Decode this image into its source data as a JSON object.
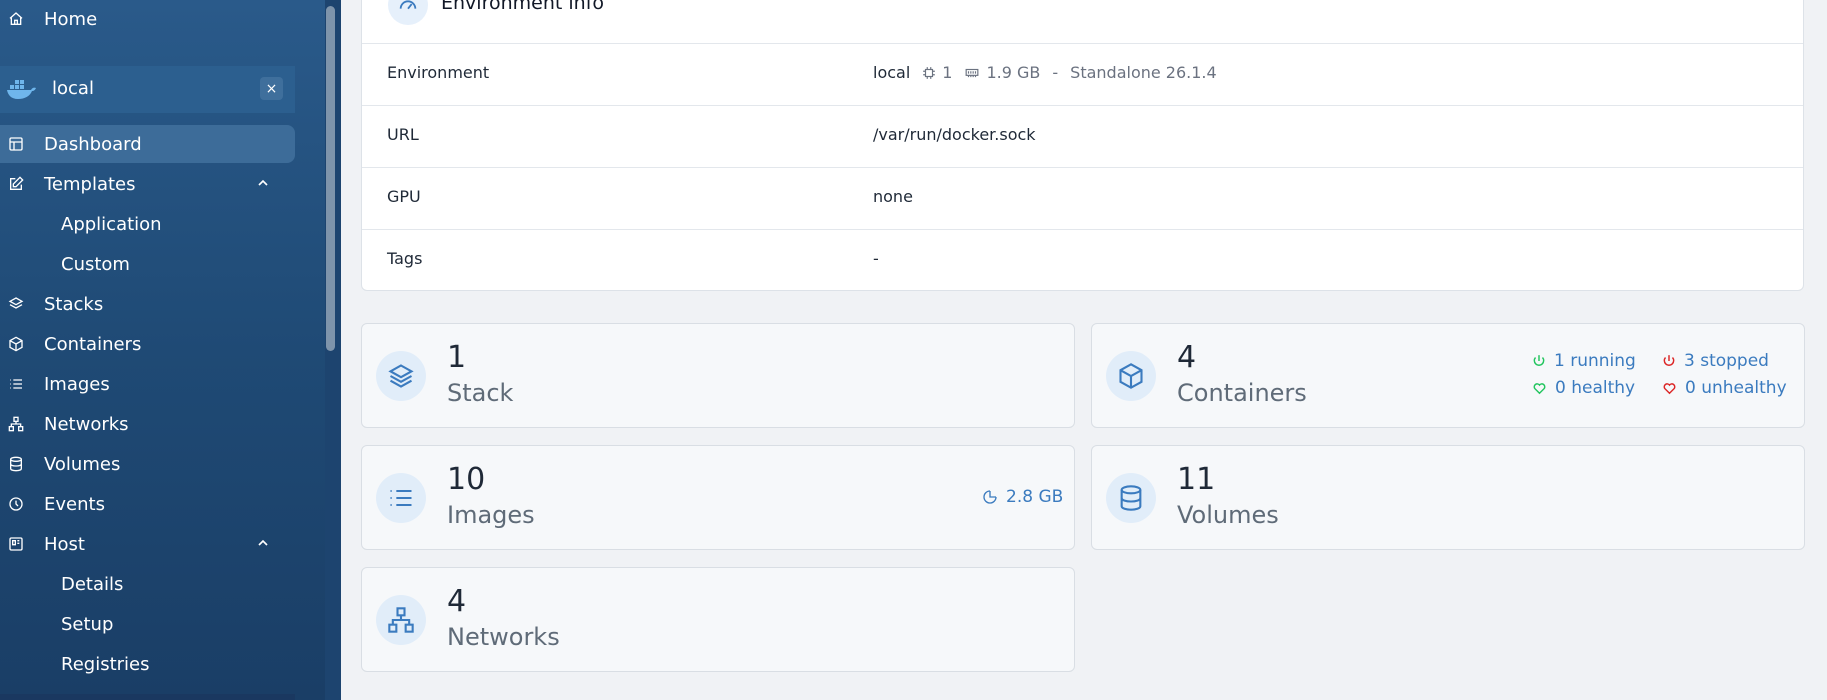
{
  "sidebar": {
    "home": "Home",
    "environment": {
      "name": "local",
      "close": "×"
    },
    "items": [
      {
        "label": "Dashboard",
        "icon": "dashboard-icon",
        "active": true
      },
      {
        "label": "Templates",
        "icon": "edit-icon",
        "expanded": true
      },
      {
        "label": "Application",
        "sub": true
      },
      {
        "label": "Custom",
        "sub": true
      },
      {
        "label": "Stacks",
        "icon": "layers-icon"
      },
      {
        "label": "Containers",
        "icon": "box-icon"
      },
      {
        "label": "Images",
        "icon": "list-icon"
      },
      {
        "label": "Networks",
        "icon": "network-icon"
      },
      {
        "label": "Volumes",
        "icon": "database-icon"
      },
      {
        "label": "Events",
        "icon": "clock-icon"
      },
      {
        "label": "Host",
        "icon": "host-icon",
        "expanded": true
      },
      {
        "label": "Details",
        "sub": true
      },
      {
        "label": "Setup",
        "sub": true
      },
      {
        "label": "Registries",
        "sub": true
      }
    ]
  },
  "env_info": {
    "title": "Environment info",
    "rows": {
      "environment": {
        "label": "Environment",
        "name": "local",
        "cpu": "1",
        "memory": "1.9 GB",
        "sep": "-",
        "type": "Standalone 26.1.4"
      },
      "url": {
        "label": "URL",
        "value": "/var/run/docker.sock"
      },
      "gpu": {
        "label": "GPU",
        "value": "none"
      },
      "tags": {
        "label": "Tags",
        "value": "-"
      }
    }
  },
  "stats": {
    "stack": {
      "count": "1",
      "label": "Stack"
    },
    "containers": {
      "count": "4",
      "label": "Containers",
      "running": "1 running",
      "stopped": "3 stopped",
      "healthy": "0 healthy",
      "unhealthy": "0 unhealthy"
    },
    "images": {
      "count": "10",
      "label": "Images",
      "size": "2.8 GB"
    },
    "volumes": {
      "count": "11",
      "label": "Volumes"
    },
    "networks": {
      "count": "4",
      "label": "Networks"
    }
  },
  "colors": {
    "sidebar": "#2a5a8a",
    "accent": "#3b7bbf",
    "running": "#22c55e",
    "stopped": "#dc2626"
  }
}
